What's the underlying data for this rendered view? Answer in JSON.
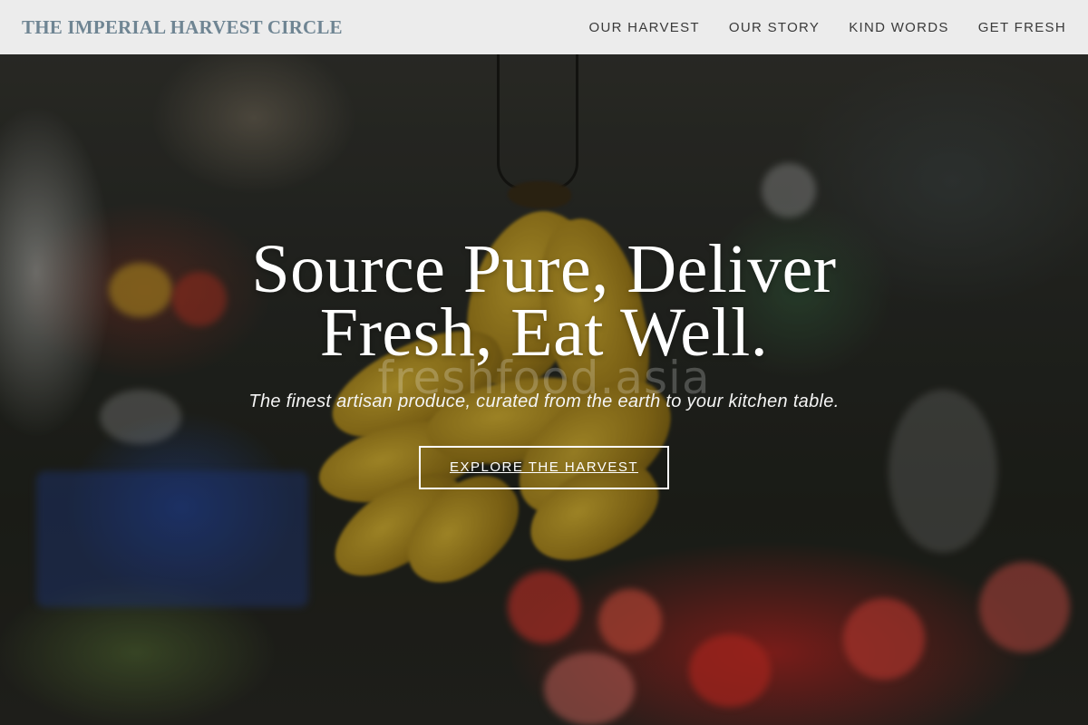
{
  "header": {
    "brand": "THE IMPERIAL HARVEST CIRCLE",
    "nav": [
      {
        "label": "OUR HARVEST"
      },
      {
        "label": "OUR STORY"
      },
      {
        "label": "KIND WORDS"
      },
      {
        "label": "GET FRESH"
      }
    ]
  },
  "hero": {
    "title_line1": "Source Pure, Deliver",
    "title_line2": "Fresh, Eat Well.",
    "watermark": "freshfood.asia",
    "subtitle": "The finest artisan produce, curated from the earth to your kitchen table.",
    "cta_label": "EXPLORE THE HARVEST"
  },
  "colors": {
    "header_bg": "#f5f5f5",
    "brand": "#6f8593",
    "nav_text": "#3a3a3a",
    "hero_text": "#ffffff"
  }
}
